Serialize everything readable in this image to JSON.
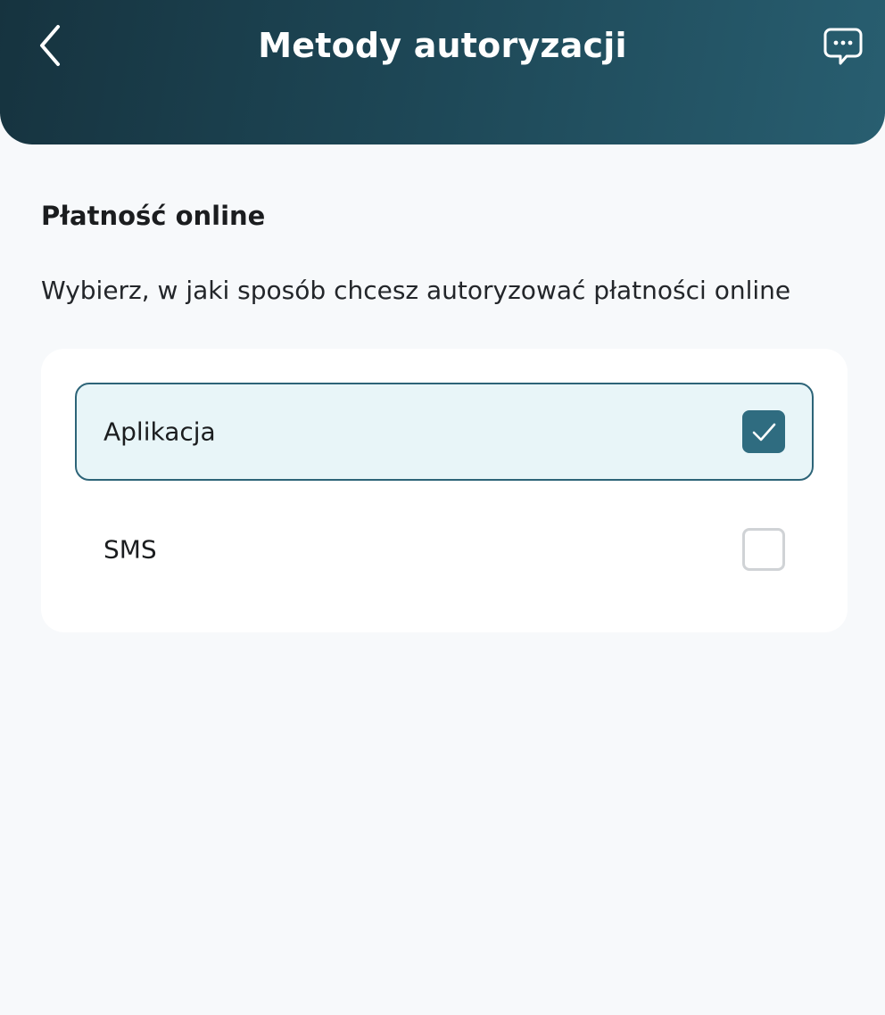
{
  "header": {
    "title": "Metody autoryzacji",
    "back_icon": "chevron-left-icon",
    "chat_icon": "chat-bubble-icon"
  },
  "section": {
    "title": "Płatność online",
    "description": "Wybierz, w jaki sposób chcesz autoryzować płatności online"
  },
  "options": [
    {
      "label": "Aplikacja",
      "checked": true
    },
    {
      "label": "SMS",
      "checked": false
    }
  ],
  "colors": {
    "header_gradient_start": "#16333f",
    "header_gradient_end": "#285e70",
    "accent": "#2f6c80",
    "selected_background": "#e8f5f8",
    "page_background": "#f7f9fb"
  }
}
